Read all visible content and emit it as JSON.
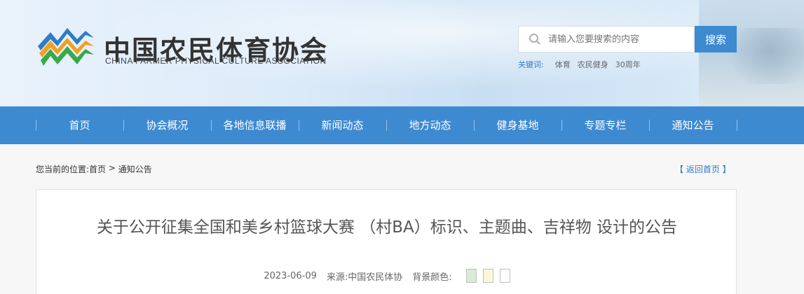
{
  "header": {
    "brand_cn": "中国农民体育协会",
    "brand_en": "CHINA FARMER PHYSICAL CULTURE ASSOCIATION",
    "search": {
      "placeholder": "请输入您要搜索的内容",
      "button_label": "搜索"
    },
    "keywords": {
      "label": "关键词:",
      "items": [
        "体育",
        "农民健身",
        "30周年"
      ]
    }
  },
  "nav": {
    "items": [
      "首页",
      "协会概况",
      "各地信息联播",
      "新闻动态",
      "地方动态",
      "健身基地",
      "专题专栏",
      "通知公告"
    ]
  },
  "breadcrumb": {
    "prefix": "您当前的位置:",
    "home": "首页",
    "separator": " > ",
    "current": "通知公告",
    "back_label": "【 返回首页 】"
  },
  "article": {
    "title": "关于公开征集全国和美乡村篮球大赛 （村BA）标识、主题曲、吉祥物 设计的公告",
    "date": "2023-06-09",
    "source": "来源:中国农民体协",
    "bg_color_label": "背景颜色:",
    "bg_colors": [
      "#d6ecd6",
      "#fbf8d8",
      "#ffffff"
    ]
  },
  "icons": {
    "logo": "association-logo-icon",
    "search": "search-icon"
  }
}
